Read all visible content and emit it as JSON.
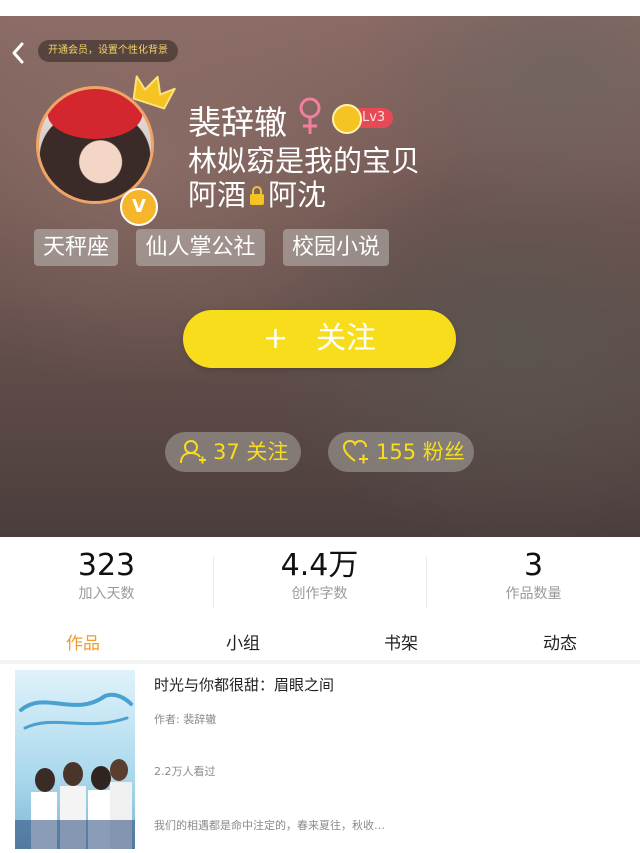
{
  "header": {
    "vip_banner": "开通会员，设置个性化背景"
  },
  "profile": {
    "username": "裴辞辙",
    "level": "Lv3",
    "bio_line1": "林姒窈是我的宝贝",
    "bio_line2_a": "阿酒",
    "bio_line2_b": "阿沈",
    "tags": [
      "天秤座",
      "仙人掌公社",
      "校园小说"
    ],
    "follow_plus": "+",
    "follow_label": "关注",
    "following": "37 关注",
    "followers": "155 粉丝"
  },
  "stats": [
    {
      "value": "323",
      "label": "加入天数"
    },
    {
      "value": "4.4万",
      "label": "创作字数"
    },
    {
      "value": "3",
      "label": "作品数量"
    }
  ],
  "tabs": [
    "作品",
    "小组",
    "书架",
    "动态"
  ],
  "active_tab": "作品",
  "book": {
    "title": "时光与你都很甜：眉眼之间",
    "author": "作者: 裴辞辙",
    "views": "2.2万人看过",
    "description": "我们的相遇都是命中注定的，春来夏往，秋收…"
  },
  "colors": {
    "accent": "#f7dd1c",
    "active_tab": "#f29b2c",
    "level_badge": "#e64a55",
    "female_icon": "#f07fa0"
  }
}
